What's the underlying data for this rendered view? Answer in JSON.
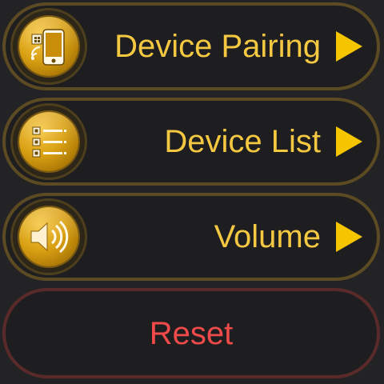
{
  "menu": {
    "items": [
      {
        "label": "Device Pairing",
        "icon": "phone-wireless-icon"
      },
      {
        "label": "Device List",
        "icon": "list-icon"
      },
      {
        "label": "Volume",
        "icon": "speaker-icon"
      }
    ],
    "arrow_icon": "chevron-right-icon",
    "label_color": "#f5c842",
    "arrow_color": "#f5c500",
    "border_color": "#5c4a22"
  },
  "reset": {
    "label": "Reset",
    "label_color": "#f04a4a",
    "border_color": "#5a2a2a"
  },
  "background_color": "#232325"
}
